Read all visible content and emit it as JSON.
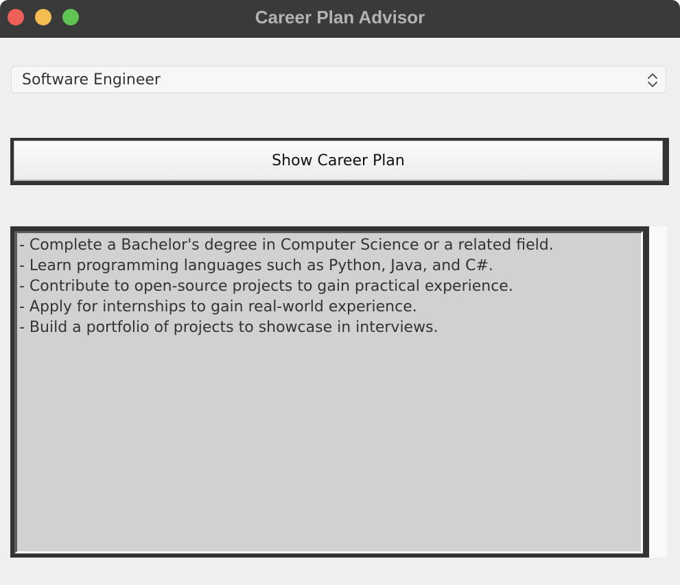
{
  "window": {
    "title": "Career Plan Advisor"
  },
  "career_select": {
    "selected": "Software Engineer"
  },
  "show_button": {
    "label": "Show Career Plan"
  },
  "plan": {
    "lines": [
      "- Complete a Bachelor's degree in Computer Science or a related field.",
      "- Learn programming languages such as Python, Java, and C#.",
      "- Contribute to open-source projects to gain practical experience.",
      "- Apply for internships to gain real-world experience.",
      "- Build a portfolio of projects to showcase in interviews."
    ]
  },
  "icons": {
    "close": "close-traffic-light",
    "minimize": "minimize-traffic-light",
    "zoom": "zoom-traffic-light",
    "select_arrows": "updown-chevron-icon"
  },
  "colors": {
    "titlebar": "#3a3a3a",
    "close": "#ee5f57",
    "minimize": "#f4bd4f",
    "zoom": "#5fc454",
    "text_area_bg": "#d1d1d1",
    "frame": "#333333"
  }
}
